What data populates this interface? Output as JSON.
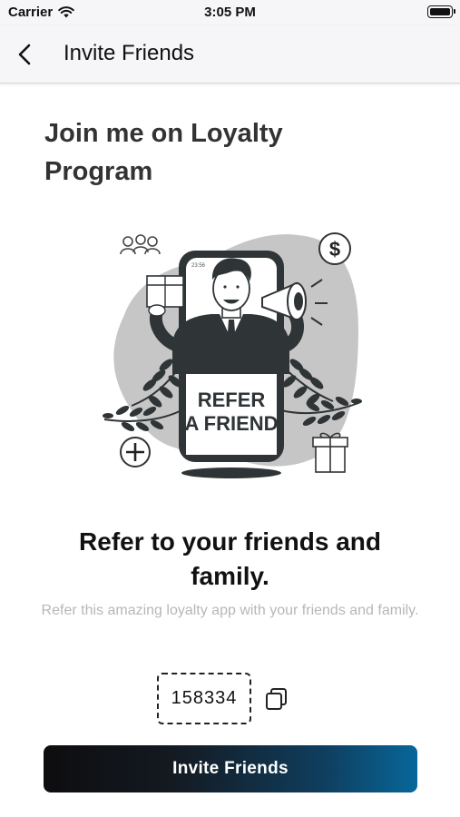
{
  "status_bar": {
    "carrier": "Carrier",
    "time": "3:05 PM"
  },
  "nav": {
    "title": "Invite Friends",
    "back_icon": "chevron-left-icon"
  },
  "heading": "Join me on Loyalty Program",
  "illustration": {
    "sign_line1": "REFER",
    "sign_line2": "A FRIEND",
    "phone_time": "23:56",
    "icons": [
      "people-icon",
      "dollar-icon",
      "plus-icon",
      "gift-icon",
      "megaphone-icon"
    ]
  },
  "refer": {
    "title": "Refer to your friends and family.",
    "subtitle": "Refer this amazing loyalty app with your friends and family."
  },
  "code": {
    "value": "158334",
    "copy_icon": "copy-icon"
  },
  "invite_button": {
    "label": "Invite Friends",
    "gradient_start": "#0d0d0f",
    "gradient_end": "#07679a"
  }
}
